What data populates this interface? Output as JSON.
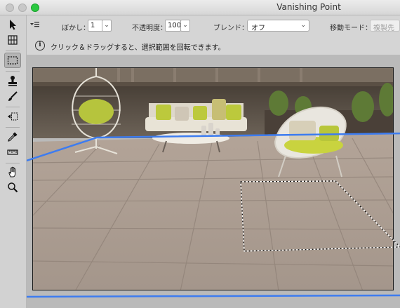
{
  "window": {
    "title": "Vanishing Point"
  },
  "toolbar": {
    "blur_label": "ぼかし：",
    "blur_value": "1",
    "opacity_label": "不透明度：",
    "opacity_value": "100",
    "blend_label": "ブレンド：",
    "blend_value": "オフ",
    "move_mode_label": "移動モード：",
    "move_mode_value": "複製先"
  },
  "hint": {
    "text": "クリック＆ドラッグすると、選択範囲を回転できます。"
  },
  "tools": [
    "arrow-tool",
    "create-plane-tool",
    "marquee-tool",
    "stamp-tool",
    "brush-tool",
    "transform-tool",
    "eyedropper-tool",
    "measure-tool",
    "hand-tool",
    "zoom-tool"
  ],
  "active_tool": "marquee-tool",
  "colors": {
    "plane_line": "#3d7cf0",
    "accent_green": "#2ac840"
  }
}
